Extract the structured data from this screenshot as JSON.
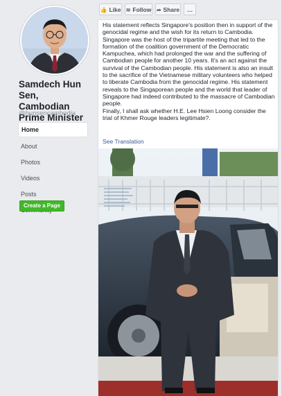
{
  "profile": {
    "name": "Samdech Hun Sen, Cambodian Prime Minister",
    "handle": "@hunsencambodia",
    "verified_icon": "check-icon"
  },
  "nav": {
    "items": [
      {
        "label": "Home",
        "active": true
      },
      {
        "label": "About"
      },
      {
        "label": "Photos"
      },
      {
        "label": "Videos"
      },
      {
        "label": "Posts"
      },
      {
        "label": "Community"
      }
    ],
    "create_page": "Create a Page"
  },
  "actions": {
    "like": "Like",
    "follow": "Follow",
    "share": "Share",
    "more": "…"
  },
  "post": {
    "text": "His statement reflects Singapore's position then in support of the genocidal regime and the wish for its return to Cambodia. Singapore was the host of the tripartite meeting that led to the formation of the coalition government of the Democratic Kampuchea, which had prolonged the war and the suffering of Cambodian people for another 10 years. It's an act against the survival of the Cambodian people. His statement is also an insult to the sacrifice of the Vietnamese military volunteers who helped to liberate Cambodia from the genocidal regime. His statement reveals to the Singaporean people and the world that leader of Singapore had indeed contributed to the massacre of Cambodian people.",
    "text2": "Finally, I shall ask whether H.E. Lee Hsien Loong consider the trial of Khmer Rouge leaders legitimate?.",
    "see_translation": "See Translation"
  },
  "colors": {
    "background": "#e9ebee",
    "link": "#385898",
    "create_button": "#42b72a",
    "verified": "#4267b2"
  }
}
